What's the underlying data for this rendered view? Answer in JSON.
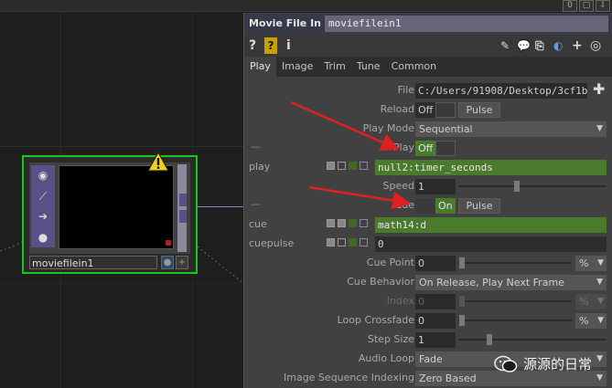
{
  "top_bar": {
    "page_count": "0"
  },
  "node": {
    "name": "moviefilein1"
  },
  "panel": {
    "op_type": "Movie File In",
    "op_name": "moviefilein1",
    "tabs": [
      {
        "label": "Play",
        "active": true
      },
      {
        "label": "Image",
        "active": false
      },
      {
        "label": "Trim",
        "active": false
      },
      {
        "label": "Tune",
        "active": false
      },
      {
        "label": "Common",
        "active": false
      }
    ],
    "params": {
      "file": {
        "label": "File",
        "value": "C:/Users/91908/Desktop/3cf1b"
      },
      "reload": {
        "label": "Reload",
        "toggle": "Off",
        "pulse": "Pulse"
      },
      "play_mode": {
        "label": "Play Mode",
        "value": "Sequential"
      },
      "play_section_dash": "—",
      "play": {
        "label": "Play",
        "toggle": "Off"
      },
      "play_expr": {
        "label": "play",
        "value": "null2:timer_seconds"
      },
      "speed": {
        "label": "Speed",
        "value": "1"
      },
      "cue_section_dash": "—",
      "cue": {
        "label": "Cue",
        "toggle": "On",
        "pulse": "Pulse"
      },
      "cue_expr": {
        "label": "cue",
        "value": "math14:d"
      },
      "cuepulse": {
        "label": "cuepulse",
        "value": "0"
      },
      "cue_point": {
        "label": "Cue Point",
        "value": "0",
        "unit": "%"
      },
      "cue_behavior": {
        "label": "Cue Behavior",
        "value": "On Release, Play Next Frame"
      },
      "index": {
        "label": "Index",
        "value": "0",
        "unit": "%"
      },
      "loop_crossfade": {
        "label": "Loop Crossfade",
        "value": "0",
        "unit": "%"
      },
      "step_size": {
        "label": "Step Size",
        "value": "1"
      },
      "audio_loop": {
        "label": "Audio Loop",
        "value": "Fade"
      },
      "image_sequence_indexing": {
        "label": "Image Sequence Indexing",
        "value": "Zero Based"
      }
    }
  },
  "watermark": {
    "text": "源源的日常"
  },
  "colors": {
    "node_border": "#1ec41e",
    "active_green": "#4a7a2c",
    "annotation_red": "#e02020",
    "header_purple": "#6a6478"
  }
}
